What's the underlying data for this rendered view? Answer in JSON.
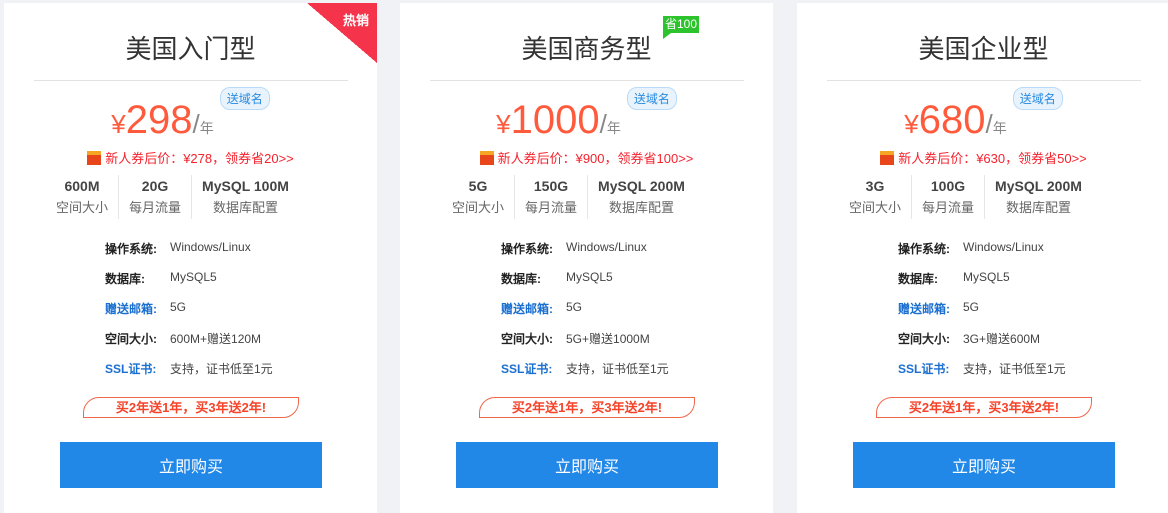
{
  "plans": [
    {
      "title": "美国入门型",
      "badge": "热销",
      "yen": "¥",
      "price": "298",
      "unit_slash": "/",
      "unit": "年",
      "domain_tag": "送域名",
      "coupon": "新人券后价：¥278，领券省20>>",
      "specs": [
        {
          "value": "600M",
          "label": "空间大小"
        },
        {
          "value": "20G",
          "label": "每月流量"
        },
        {
          "value": "MySQL 100M",
          "label": "数据库配置"
        }
      ],
      "features": [
        {
          "key": "操作系统:",
          "value": "Windows/Linux"
        },
        {
          "key": "数据库:",
          "value": "MySQL5"
        },
        {
          "key": "赠送邮箱:",
          "value": "5G"
        },
        {
          "key": "空间大小:",
          "value": "600M+赠送120M"
        },
        {
          "key": "SSL证书:",
          "value": "支持，证书低至1元"
        }
      ],
      "promo": "买2年送1年，买3年送2年!",
      "button": "立即购买"
    },
    {
      "title": "美国商务型",
      "badge": "省100",
      "yen": "¥",
      "price": "1000",
      "unit_slash": "/",
      "unit": "年",
      "domain_tag": "送域名",
      "coupon": "新人券后价：¥900，领券省100>>",
      "specs": [
        {
          "value": "5G",
          "label": "空间大小"
        },
        {
          "value": "150G",
          "label": "每月流量"
        },
        {
          "value": "MySQL 200M",
          "label": "数据库配置"
        }
      ],
      "features": [
        {
          "key": "操作系统:",
          "value": "Windows/Linux"
        },
        {
          "key": "数据库:",
          "value": "MySQL5"
        },
        {
          "key": "赠送邮箱:",
          "value": "5G"
        },
        {
          "key": "空间大小:",
          "value": "5G+赠送1000M"
        },
        {
          "key": "SSL证书:",
          "value": "支持，证书低至1元"
        }
      ],
      "promo": "买2年送1年，买3年送2年!",
      "button": "立即购买"
    },
    {
      "title": "美国企业型",
      "yen": "¥",
      "price": "680",
      "unit_slash": "/",
      "unit": "年",
      "domain_tag": "送域名",
      "coupon": "新人券后价：¥630，领券省50>>",
      "specs": [
        {
          "value": "3G",
          "label": "空间大小"
        },
        {
          "value": "100G",
          "label": "每月流量"
        },
        {
          "value": "MySQL 200M",
          "label": "数据库配置"
        }
      ],
      "features": [
        {
          "key": "操作系统:",
          "value": "Windows/Linux"
        },
        {
          "key": "数据库:",
          "value": "MySQL5"
        },
        {
          "key": "赠送邮箱:",
          "value": "5G"
        },
        {
          "key": "空间大小:",
          "value": "3G+赠送600M"
        },
        {
          "key": "SSL证书:",
          "value": "支持，证书低至1元"
        }
      ],
      "promo": "买2年送1年，买3年送2年!",
      "button": "立即购买"
    }
  ],
  "colors": {
    "accent": "#2188e8",
    "price": "#ff5a3c",
    "hot": "#f5334a",
    "save": "#2cc32c"
  }
}
